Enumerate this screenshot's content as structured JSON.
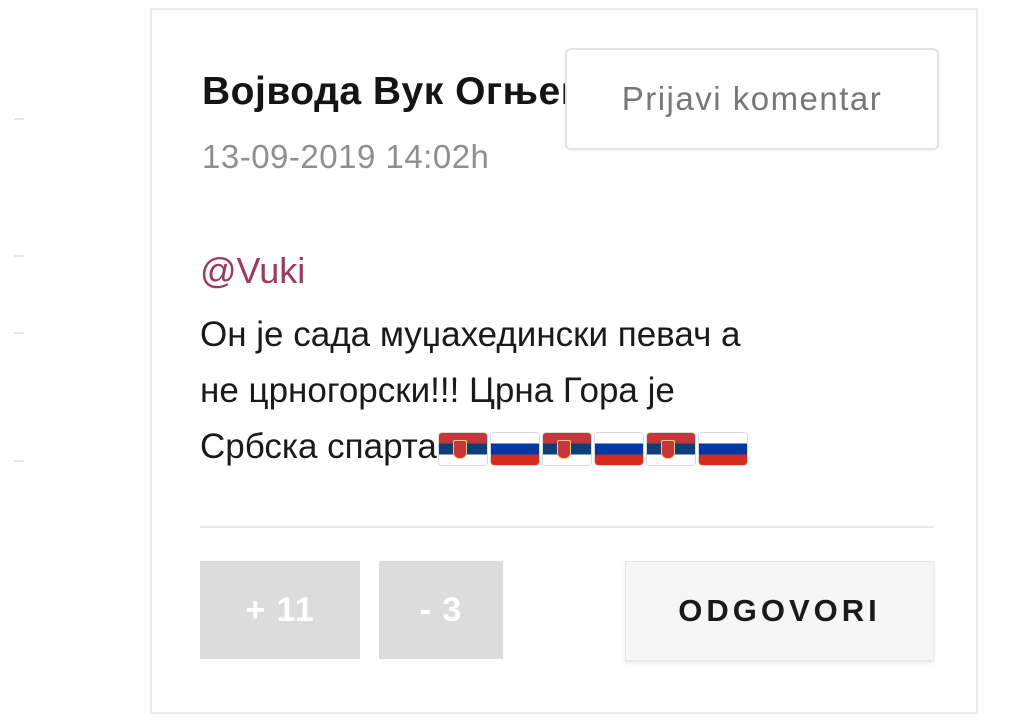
{
  "comment": {
    "author": "Војвода Вук Огњени",
    "timestamp": "13-09-2019 14:02h",
    "mention": "@Vuki",
    "body_line_1": "Он је сада муџахедински певач а",
    "body_line_2": "не црногорски!!! Црна Гора је",
    "body_line_3": "Србска спарта",
    "flags": [
      "serbia-flag-icon",
      "russia-flag-icon",
      "serbia-flag-icon",
      "russia-flag-icon",
      "serbia-flag-icon",
      "russia-flag-icon"
    ]
  },
  "actions": {
    "report_label": "Prijavi komentar",
    "upvote_label": "+ 11",
    "downvote_label": "- 3",
    "reply_label": "ODGOVORI"
  },
  "colors": {
    "mention": "#9a3a61",
    "vote_bg": "#dcdcdc",
    "reply_bg": "#f6f6f6"
  }
}
